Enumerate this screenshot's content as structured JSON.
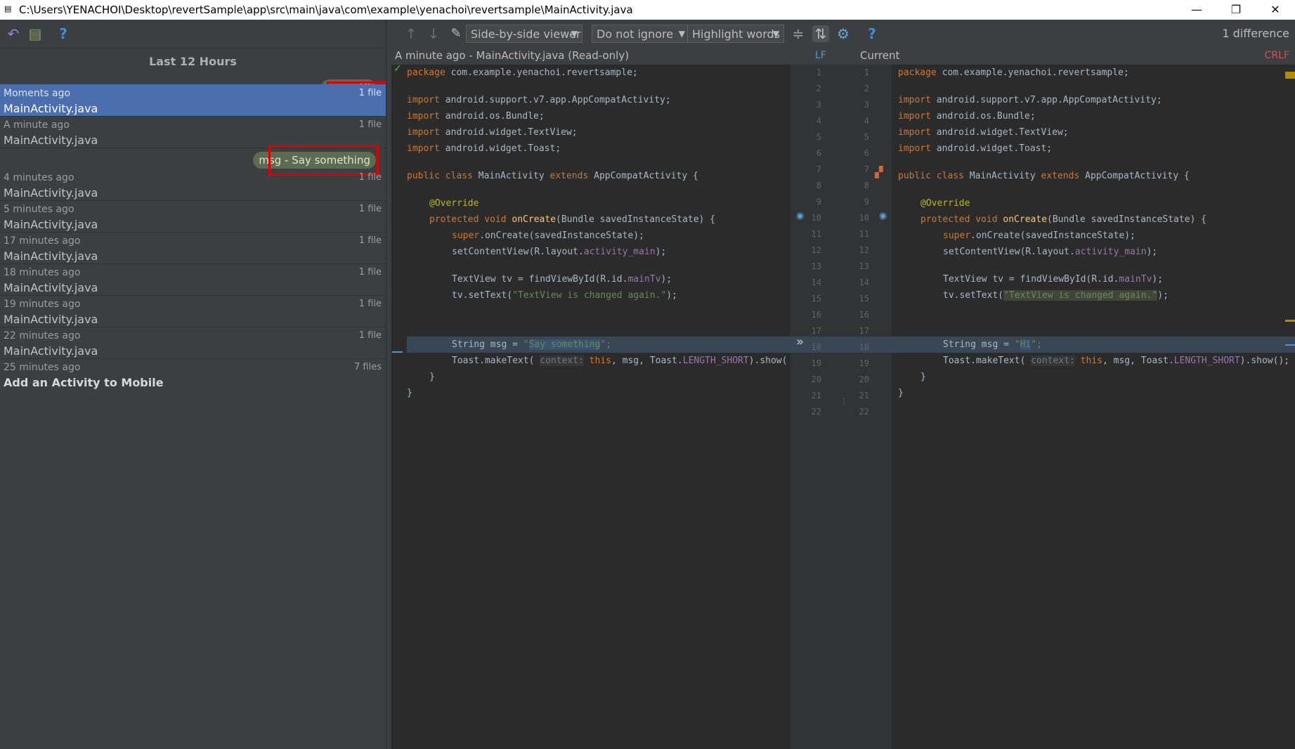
{
  "window": {
    "title": "C:\\Users\\YENACHOI\\Desktop\\revertSample\\app\\src\\main\\java\\com\\example\\yenachoi\\revertsample\\MainActivity.java",
    "minimize": "—",
    "restore": "❐",
    "close": "✕"
  },
  "history": {
    "header": "Last 12 Hours",
    "labels": [
      "msg - Hi",
      "msg - Say something"
    ],
    "revisions": [
      {
        "time": "Moments ago",
        "files": "1 file",
        "name": "MainActivity.java"
      },
      {
        "time": "A minute ago",
        "files": "1 file",
        "name": "MainActivity.java"
      },
      {
        "time": "4 minutes ago",
        "files": "1 file",
        "name": "MainActivity.java"
      },
      {
        "time": "5 minutes ago",
        "files": "1 file",
        "name": "MainActivity.java"
      },
      {
        "time": "17 minutes ago",
        "files": "1 file",
        "name": "MainActivity.java"
      },
      {
        "time": "18 minutes ago",
        "files": "1 file",
        "name": "MainActivity.java"
      },
      {
        "time": "19 minutes ago",
        "files": "1 file",
        "name": "MainActivity.java"
      },
      {
        "time": "22 minutes ago",
        "files": "1 file",
        "name": "MainActivity.java"
      },
      {
        "time": "25 minutes ago",
        "files": "7 files",
        "name": "Add an Activity to Mobile"
      }
    ]
  },
  "toolbar": {
    "viewer": "Side-by-side viewer",
    "ignore": "Do not ignore",
    "highlight": "Highlight words",
    "difference_count": "1 difference"
  },
  "diff": {
    "left_title": "A minute ago - MainActivity.java (Read-only)",
    "left_separator": "LF",
    "right_title": "Current",
    "right_separator": "CRLF",
    "line_numbers": [
      "1",
      "2",
      "3",
      "4",
      "5",
      "6",
      "7",
      "8",
      "9",
      "10",
      "11",
      "12",
      "13",
      "14",
      "15",
      "16",
      "17",
      "18",
      "19",
      "20",
      "21",
      "22"
    ],
    "code": {
      "package_kw": "package",
      "package_name": " com.example.yenachoi.revertsample;",
      "import_kw": "import",
      "imports": [
        " android.support.v7.app.AppCompatActivity;",
        " android.os.Bundle;",
        " android.widget.TextView;",
        " android.widget.Toast;"
      ],
      "public_class": "public class",
      "class_name": " MainActivity ",
      "extends_kw": "extends",
      "superclass": " AppCompatActivity {",
      "override": "@Override",
      "protected_void": "protected void",
      "oncreate": "onCreate",
      "oncreate_params": "(Bundle savedInstanceState) {",
      "super_kw": "super",
      "super_call": ".onCreate(savedInstanceState);",
      "setcontent": "setContentView(R.layout.",
      "activity_main": "activity_main",
      "close_paren": ");",
      "textview_decl": "TextView tv = findViewById(R.id.",
      "maintv": "mainTv",
      "settext": "tv.setText(",
      "settext_arg": "\"TextView is changed again.\"",
      "string_decl": "String msg = ",
      "left_msg_open": "\"",
      "left_msg_value": "Say something",
      "left_msg_close": "\";",
      "right_msg_value": "Hi",
      "toast": "Toast.makeText( ",
      "hint_context": "context:",
      "this_kw": " this",
      "toast_args": ", msg, Toast.",
      "length_short": "LENGTH_SHORT",
      "show_left": ").show(",
      "show_right": ").show();",
      "brace_inner": "}",
      "brace_outer": "}"
    }
  }
}
